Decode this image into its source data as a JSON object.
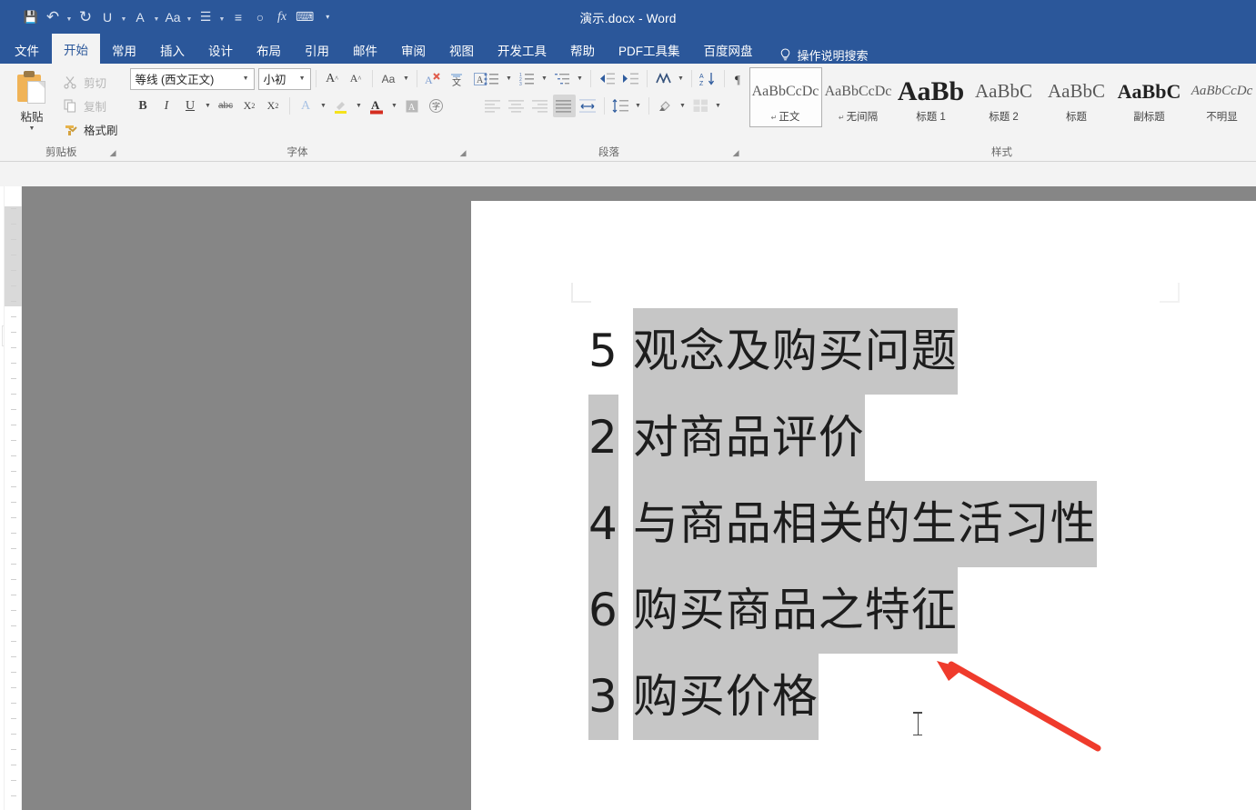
{
  "window": {
    "title": "演示.docx  -  Word"
  },
  "quick_access": [
    {
      "name": "save",
      "icon": "save-icon",
      "glyph": "💾",
      "caret": false
    },
    {
      "name": "undo",
      "icon": "undo-icon",
      "glyph": "↶",
      "caret": true
    },
    {
      "name": "redo",
      "icon": "redo-icon",
      "glyph": "↻",
      "caret": false
    },
    {
      "name": "underline",
      "icon": "underline-icon",
      "glyph": "U",
      "caret": true
    },
    {
      "name": "font-color",
      "icon": "font-color-icon",
      "glyph": "A",
      "caret": true
    },
    {
      "name": "change-case",
      "icon": "change-case-icon",
      "glyph": "Aa",
      "caret": true
    },
    {
      "name": "bullets",
      "icon": "bullet-list-icon",
      "glyph": "☰",
      "caret": true
    },
    {
      "name": "align",
      "icon": "align-icon",
      "glyph": "≡",
      "caret": false
    },
    {
      "name": "shape",
      "icon": "circle-shape-icon",
      "glyph": "○",
      "caret": false
    },
    {
      "name": "formula",
      "icon": "formula-icon",
      "glyph": "fx",
      "caret": false
    },
    {
      "name": "comment",
      "icon": "comment-icon",
      "glyph": "⌨",
      "caret": false
    },
    {
      "name": "customize",
      "icon": "more-icon",
      "glyph": "▾",
      "caret": false
    }
  ],
  "tabs": [
    {
      "label": "文件",
      "active": false
    },
    {
      "label": "开始",
      "active": true
    },
    {
      "label": "常用",
      "active": false
    },
    {
      "label": "插入",
      "active": false
    },
    {
      "label": "设计",
      "active": false
    },
    {
      "label": "布局",
      "active": false
    },
    {
      "label": "引用",
      "active": false
    },
    {
      "label": "邮件",
      "active": false
    },
    {
      "label": "审阅",
      "active": false
    },
    {
      "label": "视图",
      "active": false
    },
    {
      "label": "开发工具",
      "active": false
    },
    {
      "label": "帮助",
      "active": false
    },
    {
      "label": "PDF工具集",
      "active": false
    },
    {
      "label": "百度网盘",
      "active": false
    }
  ],
  "tell_me": {
    "icon": "lightbulb-icon",
    "label": "操作说明搜索"
  },
  "ribbon": {
    "clipboard": {
      "group_label": "剪贴板",
      "paste_label": "粘贴",
      "commands": [
        {
          "label": "剪切",
          "icon": "scissors-icon",
          "disabled": true
        },
        {
          "label": "复制",
          "icon": "copy-icon",
          "disabled": true
        },
        {
          "label": "格式刷",
          "icon": "format-painter-icon",
          "disabled": false
        }
      ]
    },
    "font": {
      "group_label": "字体",
      "font_name": "等线 (西文正文)",
      "font_size": "小初",
      "row1": [
        {
          "name": "grow-font",
          "icon": "increase-font-icon",
          "glyph": "Aˆ"
        },
        {
          "name": "shrink-font",
          "icon": "decrease-font-icon",
          "glyph": "Aˇ"
        },
        {
          "name": "change-case",
          "icon": "change-case-icon",
          "glyph": "Aa",
          "caret": true
        },
        {
          "name": "clear-formatting",
          "icon": "clear-formatting-icon",
          "glyph": "A✐"
        },
        {
          "name": "phonetic-guide",
          "icon": "phonetic-guide-icon",
          "glyph": "安"
        },
        {
          "name": "character-border",
          "icon": "character-border-icon",
          "glyph": "A"
        }
      ],
      "row2": [
        {
          "name": "bold",
          "icon": "bold-icon",
          "glyph": "B"
        },
        {
          "name": "italic",
          "icon": "italic-icon",
          "glyph": "I"
        },
        {
          "name": "underline",
          "icon": "underline-icon",
          "glyph": "U",
          "caret": true
        },
        {
          "name": "strikethrough",
          "icon": "strikethrough-icon",
          "glyph": "abc"
        },
        {
          "name": "subscript",
          "icon": "subscript-icon",
          "glyph": "X₂"
        },
        {
          "name": "superscript",
          "icon": "superscript-icon",
          "glyph": "X²"
        },
        {
          "name": "text-effects",
          "icon": "text-effects-icon",
          "glyph": "A",
          "caret": true
        },
        {
          "name": "text-highlight",
          "icon": "highlight-icon",
          "glyph": "✎",
          "caret": true
        },
        {
          "name": "font-color",
          "icon": "font-color-icon",
          "glyph": "A",
          "caret": true
        },
        {
          "name": "character-shading",
          "icon": "character-shading-icon",
          "glyph": "A"
        },
        {
          "name": "enclose-character",
          "icon": "enclose-character-icon",
          "glyph": "字"
        }
      ]
    },
    "paragraph": {
      "group_label": "段落",
      "row1": [
        {
          "name": "bullets",
          "icon": "bullet-list-icon",
          "caret": true
        },
        {
          "name": "numbering",
          "icon": "numbered-list-icon",
          "caret": true
        },
        {
          "name": "multilevel-list",
          "icon": "multilevel-list-icon",
          "caret": true
        },
        {
          "name": "decrease-indent",
          "icon": "decrease-indent-icon",
          "caret": false
        },
        {
          "name": "increase-indent",
          "icon": "increase-indent-icon",
          "caret": false
        },
        {
          "name": "chinese-layout",
          "icon": "asian-layout-icon",
          "caret": true
        },
        {
          "name": "sort",
          "icon": "sort-icon",
          "caret": false
        },
        {
          "name": "show-marks",
          "icon": "paragraph-mark-icon",
          "caret": false
        }
      ],
      "row2": [
        {
          "name": "align-left",
          "icon": "align-left-icon"
        },
        {
          "name": "align-center",
          "icon": "align-center-icon"
        },
        {
          "name": "align-right",
          "icon": "align-right-icon"
        },
        {
          "name": "justify",
          "icon": "justify-icon",
          "active": true
        },
        {
          "name": "distribute",
          "icon": "distribute-icon"
        },
        {
          "name": "line-spacing",
          "icon": "line-spacing-icon",
          "caret": true
        },
        {
          "name": "shading",
          "icon": "shading-icon",
          "caret": true
        },
        {
          "name": "borders",
          "icon": "borders-icon",
          "caret": true
        }
      ]
    },
    "styles": {
      "group_label": "样式",
      "items": [
        {
          "preview": "AaBbCcDc",
          "name": "正文",
          "mark": "↵",
          "size": 16,
          "bold": false,
          "selected": true
        },
        {
          "preview": "AaBbCcDc",
          "name": "无间隔",
          "mark": "↵",
          "size": 16,
          "bold": false,
          "selected": false
        },
        {
          "preview": "AaBb",
          "name": "标题 1",
          "mark": "",
          "size": 30,
          "bold": true,
          "selected": false
        },
        {
          "preview": "AaBbC",
          "name": "标题 2",
          "mark": "",
          "size": 21,
          "bold": false,
          "selected": false
        },
        {
          "preview": "AaBbC",
          "name": "标题",
          "mark": "",
          "size": 21,
          "bold": false,
          "selected": false
        },
        {
          "preview": "AaBbC",
          "name": "副标题",
          "mark": "",
          "size": 22,
          "bold": true,
          "selected": false
        },
        {
          "preview": "AaBbCcDc",
          "name": "不明显",
          "mark": "",
          "size": 15,
          "bold": false,
          "selected": false
        }
      ]
    }
  },
  "document": {
    "lines": [
      {
        "num": "5",
        "text": "观念及购买问题",
        "num_highlighted": false
      },
      {
        "num": "2",
        "text": "对商品评价",
        "num_highlighted": true
      },
      {
        "num": "4",
        "text": "与商品相关的生活习性",
        "num_highlighted": true
      },
      {
        "num": "6",
        "text": "购买商品之特征",
        "num_highlighted": true
      },
      {
        "num": "3",
        "text": "购买价格",
        "num_highlighted": true
      }
    ]
  },
  "annotation": {
    "arrow_color": "#ef3b2c"
  },
  "colors": {
    "title_bar": "#2b579a",
    "ribbon_bg": "#f3f3f3",
    "selection": "#c6c6c6",
    "canvas": "#868686"
  }
}
